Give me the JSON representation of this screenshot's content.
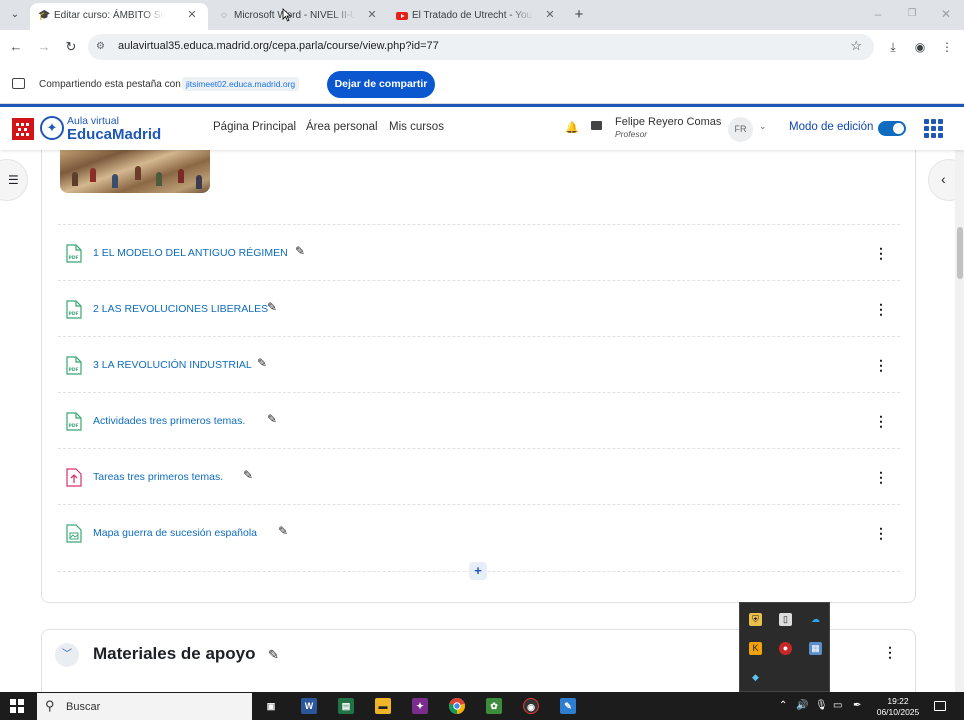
{
  "browser": {
    "tabs": [
      {
        "title": "Editar curso: ÁMBITO SOCIAL",
        "favicon": "moodle-hat-icon",
        "active": true
      },
      {
        "title": "Microsoft Word - NIVEL II-UNIDAD",
        "favicon": "loading-spinner-icon",
        "active": false
      },
      {
        "title": "El Tratado de Utrecht - YouTube",
        "favicon": "youtube-icon",
        "active": false
      }
    ],
    "url": "aulavirtual35.educa.madrid.org/cepa.parla/course/view.php?id=77"
  },
  "sharing": {
    "label": "Compartiendo esta pestaña con",
    "host": "jitsimeet02.educa.madrid.org",
    "stop_button": "Dejar de compartir"
  },
  "site": {
    "logo_small": "Aula virtual",
    "logo_big": "EducaMadrid",
    "nav": [
      "Página Principal",
      "Área personal",
      "Mis cursos"
    ],
    "user_name": "Felipe Reyero Comas",
    "user_role": "Profesor",
    "user_initials": "FR",
    "edit_mode_label": "Modo de edición",
    "edit_mode_on": true
  },
  "activities": [
    {
      "name": "1 EL MODELO DEL ANTIGUO RÉGIMEN",
      "icon": "pdf-icon"
    },
    {
      "name": "2 LAS REVOLUCIONES LIBERALES",
      "icon": "pdf-icon"
    },
    {
      "name": "3 LA REVOLUCIÓN INDUSTRIAL",
      "icon": "pdf-icon"
    },
    {
      "name": "Actividades tres primeros temas.",
      "icon": "pdf-icon"
    },
    {
      "name": "Tareas tres primeros temas.",
      "icon": "assignment-upload-icon"
    },
    {
      "name": "Mapa guerra de sucesión española",
      "icon": "image-file-icon"
    }
  ],
  "next_section": {
    "title": "Materiales de apoyo"
  },
  "taskbar": {
    "search_placeholder": "Buscar",
    "time": "19:22",
    "date": "06/10/2025"
  },
  "colors": {
    "brand_blue": "#1f57b8",
    "link_blue": "#0f6cbf",
    "madrid_red": "#d1131a",
    "share_button": "#0b57d0"
  }
}
